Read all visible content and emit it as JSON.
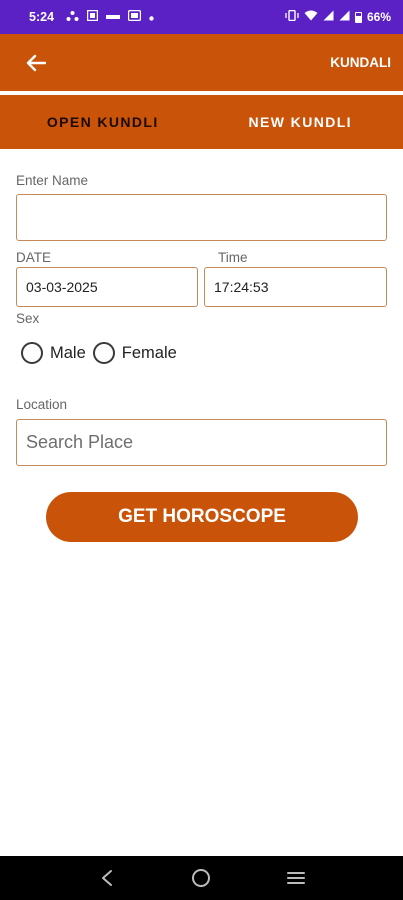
{
  "status_bar": {
    "time": "5:24",
    "battery_percent": "66%",
    "left_icons": [
      "network-icon",
      "qr-icon",
      "volte-icon",
      "signal-app-icon",
      "dot-icon"
    ],
    "right_icons": [
      "vibrate-icon",
      "wifi-icon",
      "signal-icon",
      "signal-icon",
      "battery-icon"
    ]
  },
  "app_bar": {
    "title": "KUNDALI",
    "back_icon": "arrow-left-icon"
  },
  "tabs": [
    {
      "label": "OPEN KUNDLI",
      "selected": false
    },
    {
      "label": "NEW KUNDLI",
      "selected": true
    }
  ],
  "form": {
    "name_label": "Enter Name",
    "name_value": "",
    "date_label": "DATE",
    "date_value": "03-03-2025",
    "time_label": "Time",
    "time_value": "17:24:53",
    "sex_label": "Sex",
    "sex_options": [
      "Male",
      "Female"
    ],
    "location_label": "Location",
    "location_placeholder": "Search Place",
    "submit_label": "GET HOROSCOPE"
  },
  "colors": {
    "status_bar": "#5b21c4",
    "accent": "#c95309",
    "field_border": "#c58a5a"
  },
  "nav_bar": {
    "buttons": [
      "back-nav-icon",
      "home-nav-icon",
      "recents-nav-icon"
    ]
  }
}
